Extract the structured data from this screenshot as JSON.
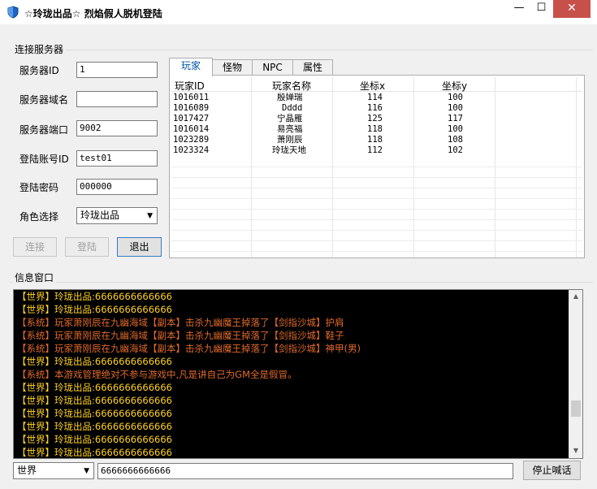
{
  "window": {
    "title": "☆玲珑出品☆  烈焰假人脱机登陆",
    "minimize_glyph": "—",
    "maximize_glyph": "☐",
    "close_glyph": "✕"
  },
  "connect": {
    "group_label": "连接服务器",
    "fields": [
      {
        "label": "服务器ID",
        "value": "1"
      },
      {
        "label": "服务器域名",
        "value": ""
      },
      {
        "label": "服务器端口",
        "value": "9002"
      },
      {
        "label": "登陆账号ID",
        "value": "test01"
      },
      {
        "label": "登陆密码",
        "value": "000000"
      }
    ],
    "role_label": "角色选择",
    "role_value": "玲珑出品",
    "buttons": {
      "connect": "连接",
      "login": "登陆",
      "exit": "退出"
    }
  },
  "tabs": [
    "玩家",
    "怪物",
    "NPC",
    "属性"
  ],
  "player_table": {
    "headers": [
      "玩家ID",
      "玩家名称",
      "坐标x",
      "坐标y"
    ],
    "rows": [
      [
        "1016011",
        "殷婵瑞",
        "114",
        "100"
      ],
      [
        "1016089",
        "Dddd",
        "116",
        "100"
      ],
      [
        "1017427",
        "宁晶雁",
        "125",
        "117"
      ],
      [
        "1016014",
        "易亮福",
        "118",
        "100"
      ],
      [
        "1023289",
        "萧刚辰",
        "118",
        "108"
      ],
      [
        "1023324",
        "玲珑天地",
        "112",
        "102"
      ]
    ]
  },
  "info": {
    "group_label": "信息窗口",
    "lines": [
      {
        "text": "【世界】玲珑出品:6666666666666",
        "color": "#ffd21f"
      },
      {
        "text": "【世界】玲珑出品:6666666666666",
        "color": "#ffd21f"
      },
      {
        "text": "【系统】玩家萧刚辰在九幽海域【副本】击杀九幽魔王掉落了【剑指沙城】护肩",
        "color": "#e06a2a"
      },
      {
        "text": "【系统】玩家萧刚辰在九幽海域【副本】击杀九幽魔王掉落了【剑指沙城】鞋子",
        "color": "#e06a2a"
      },
      {
        "text": "【系统】玩家萧刚辰在九幽海域【副本】击杀九幽魔王掉落了【剑指沙城】神甲(男)",
        "color": "#e06a2a"
      },
      {
        "text": "【世界】玲珑出品:6666666666666",
        "color": "#ffd21f"
      },
      {
        "text": "【系统】本游戏管理绝对不参与游戏中,凡是讲自己为GM全是假冒。",
        "color": "#e06a2a"
      },
      {
        "text": "【世界】玲珑出品:6666666666666",
        "color": "#ffd21f"
      },
      {
        "text": "【世界】玲珑出品:6666666666666",
        "color": "#ffd21f"
      },
      {
        "text": "【世界】玲珑出品:6666666666666",
        "color": "#ffd21f"
      },
      {
        "text": "【世界】玲珑出品:6666666666666",
        "color": "#ffd21f"
      },
      {
        "text": "【世界】玲珑出品:6666666666666",
        "color": "#ffd21f"
      },
      {
        "text": "【世界】玲珑出品:6666666666666",
        "color": "#ffd21f"
      }
    ]
  },
  "chat": {
    "channel": "世界",
    "message": "6666666666666",
    "stop_button": "停止喊话"
  },
  "colors": {
    "accent": "#0055a4",
    "close_button": "#c7504b",
    "log_background": "#000000"
  }
}
